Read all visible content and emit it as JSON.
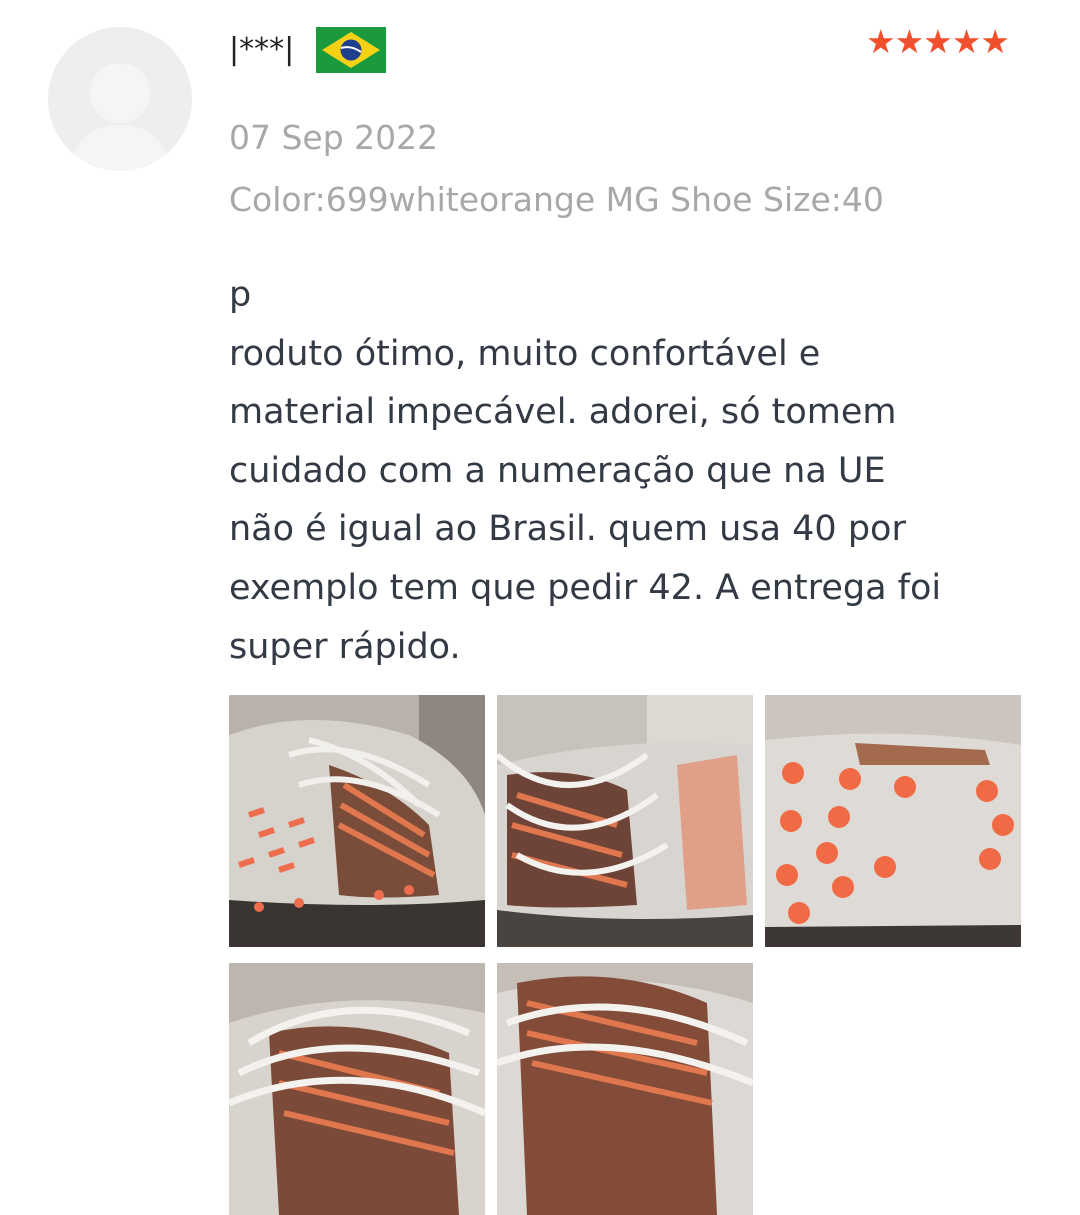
{
  "review": {
    "username": "|***|",
    "country_flag": "brazil-flag",
    "rating": 5,
    "stars_text": "★★★★★",
    "star_color": "#f0502e",
    "date": "07 Sep 2022",
    "sku": "Color:699whiteorange MG Shoe Size:40",
    "text_lines": [
      "p",
      "roduto ótimo, muito confortável e",
      "material impecável. adorei, só tomem",
      "cuidado com a numeração que na UE",
      "não é igual ao Brasil. quem usa 40 por",
      "exemplo tem que pedir 42. A entrega foi",
      "super rápido."
    ],
    "photos": [
      "shoe-photo-1",
      "shoe-photo-2",
      "shoe-photo-3",
      "shoe-photo-4",
      "shoe-photo-5"
    ]
  }
}
